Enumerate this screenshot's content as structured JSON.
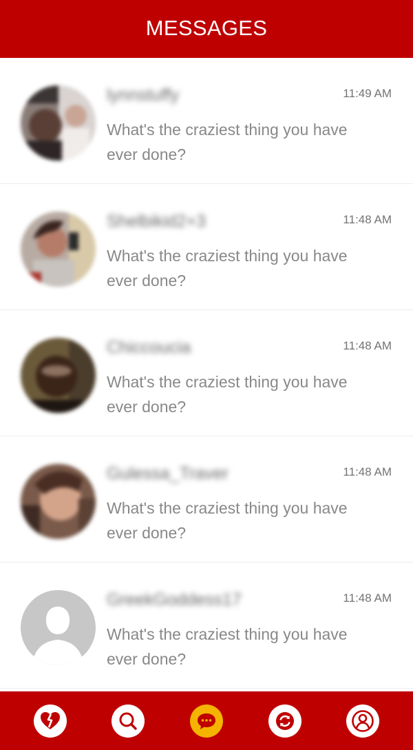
{
  "header": {
    "title": "MESSAGES"
  },
  "conversations": [
    {
      "name": "lynnstuffy",
      "time": "11:49 AM",
      "preview": "What's the craziest thing you have ever done?"
    },
    {
      "name": "Shelbikid2+3",
      "time": "11:48 AM",
      "preview": "What's the craziest thing you have ever done?"
    },
    {
      "name": "Chiccoucia",
      "time": "11:48 AM",
      "preview": "What's the craziest thing you have ever done?"
    },
    {
      "name": "Gulessa_Traver",
      "time": "11:48 AM",
      "preview": "What's the craziest thing you have ever done?"
    },
    {
      "name": "GreekGoddess17",
      "time": "11:48 AM",
      "preview": "What's the craziest thing you have ever done?"
    }
  ],
  "nav": {
    "items": [
      "broken-heart-icon",
      "search-icon",
      "chat-icon",
      "refresh-icon",
      "profile-icon"
    ],
    "active": "chat-icon"
  },
  "colors": {
    "brand_red": "#bf0000",
    "active_nav": "#f4b400",
    "time_text": "#737373",
    "preview_text": "#888888"
  }
}
